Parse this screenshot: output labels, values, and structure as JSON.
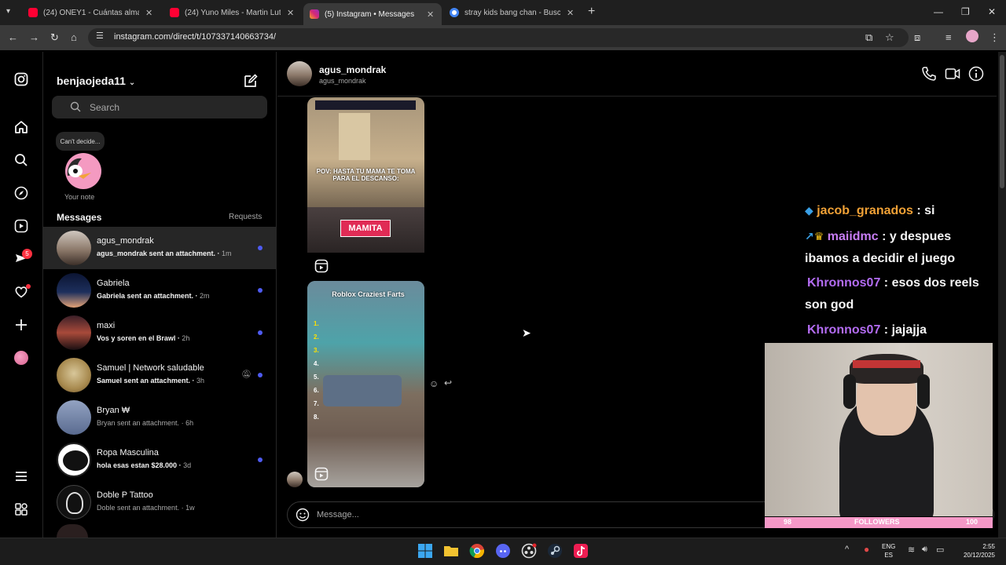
{
  "browser": {
    "tabs": [
      {
        "title": "(24) ONEY1 - Cuántas almas pu",
        "favicon_color": "#ff0033",
        "active": false
      },
      {
        "title": "(24) Yuno Miles - Martin Luther",
        "favicon_color": "#ff0033",
        "active": false
      },
      {
        "title": "(5) Instagram • Messages",
        "favicon_color": "#d62976",
        "active": true
      },
      {
        "title": "stray kids bang chan - Buscar c",
        "favicon_color": "#4285f4",
        "active": false
      }
    ],
    "url": "instagram.com/direct/t/107337140663734/"
  },
  "sidebar": {
    "notifications_badge": "5"
  },
  "inbox": {
    "username": "benjaojeda11",
    "search_placeholder": "Search",
    "note_text": "Can't decide...",
    "note_label": "Your note",
    "messages_heading": "Messages",
    "requests_label": "Requests",
    "conversations": [
      {
        "name": "agus_mondrak",
        "preview": "agus_mondrak sent an attachment.",
        "time": "1m",
        "unread": true,
        "selected": true
      },
      {
        "name": "Gabriela",
        "preview": "Gabriela sent an attachment.",
        "time": "2m",
        "unread": true,
        "selected": false
      },
      {
        "name": "maxi",
        "preview": "Vos y soren en el Brawl",
        "time": "2h",
        "unread": true,
        "selected": false
      },
      {
        "name": "Samuel | Network saludable",
        "preview": "Samuel sent an attachment.",
        "time": "3h",
        "unread": true,
        "selected": false
      },
      {
        "name": "Bryan ₩",
        "preview": "Bryan sent an attachment.",
        "time": "6h",
        "unread": false,
        "selected": false
      },
      {
        "name": "Ropa Masculina",
        "preview": "hola esas estan $28.000",
        "time": "3d",
        "unread": true,
        "selected": false
      },
      {
        "name": "Doble P Tattoo",
        "preview": "Doble sent an attachment.",
        "time": "1w",
        "unread": false,
        "selected": false
      }
    ]
  },
  "chat": {
    "name": "agus_mondrak",
    "handle": "agus_mondrak",
    "reel1": {
      "caption": "POV: HASTA TU MAMA TE TOMA PARA EL DESCANSO:",
      "label": "MAMITA"
    },
    "reel2": {
      "caption": "Roblox Craziest Farts",
      "list": [
        "1.",
        "2.",
        "3.",
        "4.",
        "5.",
        "6.",
        "7.",
        "8."
      ]
    },
    "message_placeholder": "Message..."
  },
  "stream_chat": [
    {
      "user": "",
      "text": "",
      "user_color": "#ffffff"
    },
    {
      "user": "jacob_granados",
      "text": " : si",
      "user_color": "#f0a136"
    },
    {
      "user": "maiidmc",
      "text": " : y despues ibamos a decidir el juego",
      "user_color": "#c77df3"
    },
    {
      "user": "Khronnos07",
      "text": " : esos dos reels son god",
      "user_color": "#b36cf2"
    },
    {
      "user": "Khronnos07",
      "text": " : jajajja",
      "user_color": "#b36cf2"
    }
  ],
  "followers_bar": {
    "current": "98",
    "label": "FOLLOWERS",
    "goal": "100"
  },
  "taskbar": {
    "lang": "ENG",
    "region": "ES",
    "time": "2:55",
    "date": "20/12/2025"
  }
}
